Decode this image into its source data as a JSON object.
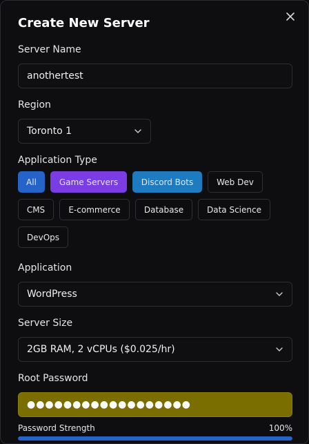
{
  "dialog": {
    "title": "Create New Server",
    "close_icon": "close-icon"
  },
  "server_name": {
    "label": "Server Name",
    "value": "anothertest"
  },
  "region": {
    "label": "Region",
    "selected": "Toronto 1"
  },
  "application_type": {
    "label": "Application Type",
    "chips": [
      {
        "label": "All",
        "active": true,
        "color": "#2563c9"
      },
      {
        "label": "Game Servers",
        "color": "#7a3ce3"
      },
      {
        "label": "Discord Bots",
        "color": "#1e7bbf"
      },
      {
        "label": "Web Dev"
      },
      {
        "label": "CMS"
      },
      {
        "label": "E-commerce"
      },
      {
        "label": "Database"
      },
      {
        "label": "Data Science"
      },
      {
        "label": "DevOps"
      }
    ]
  },
  "application": {
    "label": "Application",
    "selected": "WordPress"
  },
  "server_size": {
    "label": "Server Size",
    "selected": "2GB RAM, 2 vCPUs ($0.025/hr)"
  },
  "root_password": {
    "label": "Root Password",
    "masked_value": "●●●●●●●●●●●●●●●●●●",
    "background_color": "#7a6e00"
  },
  "password_strength": {
    "label": "Password Strength",
    "value_text": "100%",
    "fraction": 1.0,
    "color": "#2563c9"
  }
}
